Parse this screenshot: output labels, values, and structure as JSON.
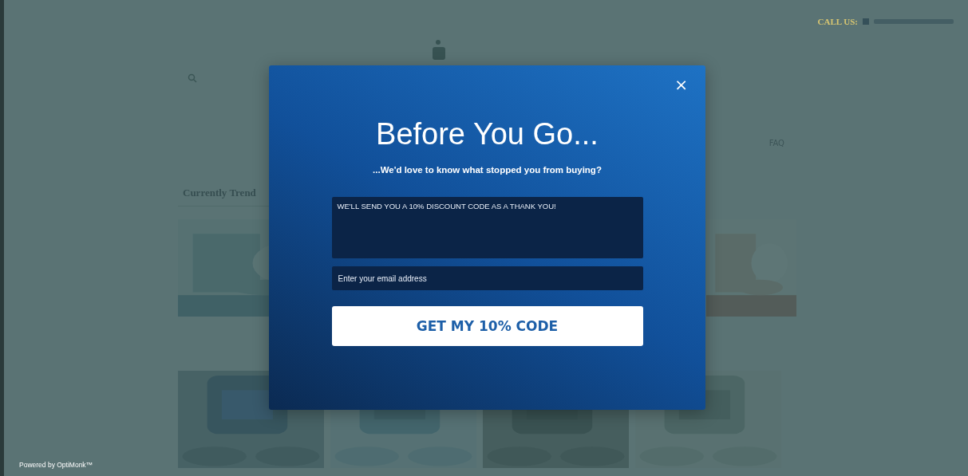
{
  "store": {
    "call_label": "CALL US:",
    "nav_link": "FAQ",
    "section_title": "Currently Trend"
  },
  "popup": {
    "close": "×",
    "title": "Before You Go...",
    "subtitle": "...We'd love to know what stopped you from buying?",
    "message_field": {
      "placeholder": "WE'LL SEND YOU A 10% DISCOUNT CODE AS A THANK YOU!"
    },
    "email_field": {
      "placeholder": "Enter your email address"
    },
    "button": "GET MY 10% CODE"
  },
  "footer": "Powered by OptiMonk™"
}
